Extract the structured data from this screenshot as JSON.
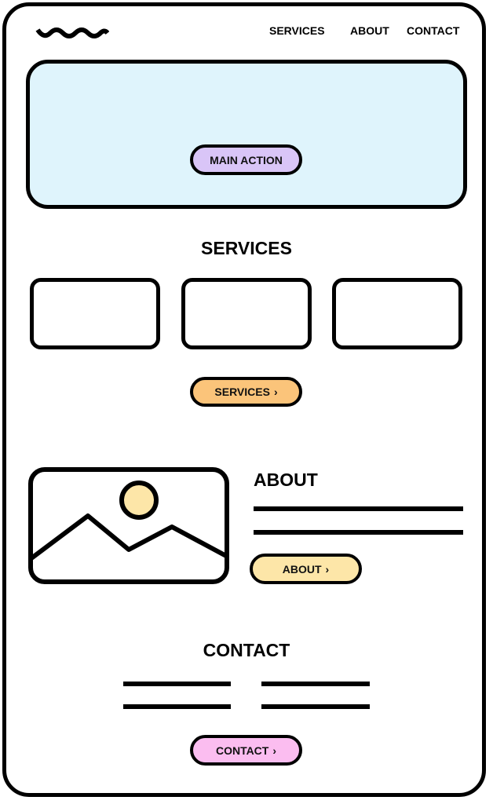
{
  "nav": {
    "logo_icon": "wave-logo",
    "items": [
      {
        "label": "SERVICES"
      },
      {
        "label": "ABOUT"
      },
      {
        "label": "CONTACT"
      }
    ]
  },
  "hero": {
    "button_label": "MAIN ACTION",
    "background_color": "#dff4fc",
    "button_color": "#d9c5f7"
  },
  "services": {
    "title": "SERVICES",
    "card_count": 3,
    "button_label": "SERVICES",
    "button_icon": "chevron-right-icon",
    "button_color": "#fbc47a"
  },
  "about": {
    "title": "ABOUT",
    "image_icon": "image-placeholder-icon",
    "sun_color": "#fde6a8",
    "button_label": "ABOUT",
    "button_icon": "chevron-right-icon",
    "button_color": "#fde6a8"
  },
  "contact": {
    "title": "CONTACT",
    "button_label": "CONTACT",
    "button_icon": "chevron-right-icon",
    "button_color": "#fbbdf0"
  },
  "chevron": "›"
}
